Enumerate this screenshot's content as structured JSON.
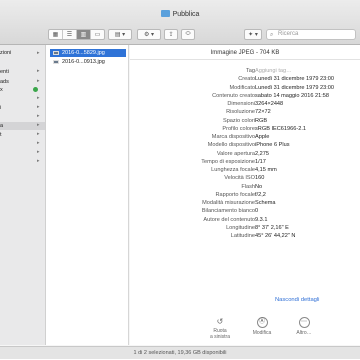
{
  "window": {
    "title": "Pubblica"
  },
  "toolbar": {
    "view_icons": [
      "▦",
      "☰",
      "▥",
      "▭"
    ],
    "group_icon": "▤ ▾",
    "action_icon": "⚙ ▾",
    "share_icon": "⇪",
    "tag_icon": "⬭",
    "dropbox_icon": "✦ ▾",
    "search_placeholder": "Ricerca"
  },
  "sidebar": {
    "items": [
      {
        "label": "zioni"
      },
      {
        "label": "enti"
      },
      {
        "label": "ads"
      },
      {
        "label": "x"
      },
      {
        "label": "i"
      },
      {
        "label": "a"
      },
      {
        "label": "t"
      }
    ]
  },
  "files": [
    {
      "name": "2016-0...5829.jpg",
      "selected": true
    },
    {
      "name": "2016-0...0913.jpg",
      "selected": false
    }
  ],
  "preview": {
    "kind": "Immagine JPEG - 704 KB",
    "rows": [
      {
        "key": "Tag",
        "value": "Aggiungi tag…"
      },
      {
        "key": "Creato",
        "value": "Lunedì 31 dicembre 1979 23:00"
      },
      {
        "key": "Modificato",
        "value": "Lunedì 31 dicembre 1979 23:00"
      },
      {
        "key": "Contenuto creato",
        "value": "sabato 14 maggio 2016 21:58"
      },
      {
        "key": "Dimensioni",
        "value": "3264×2448"
      },
      {
        "key": "Risoluzione",
        "value": "72×72"
      },
      {
        "key": "Spazio colori",
        "value": "RGB"
      },
      {
        "key": "Profilo colore",
        "value": "sRGB IEC61966-2.1"
      },
      {
        "key": "Marca dispositivo",
        "value": "Apple"
      },
      {
        "key": "Modello dispositivo",
        "value": "iPhone 6 Plus"
      },
      {
        "key": "Valore apertura",
        "value": "2,275"
      },
      {
        "key": "Tempo di esposizione",
        "value": "1/17"
      },
      {
        "key": "Lunghezza focale",
        "value": "4,15 mm"
      },
      {
        "key": "Velocità ISO",
        "value": "160"
      },
      {
        "key": "Flash",
        "value": "No"
      },
      {
        "key": "Rapporto focale",
        "value": "f/2,2"
      },
      {
        "key": "Modalità misurazione",
        "value": "Schema"
      },
      {
        "key": "Bilanciamento bianco",
        "value": "0"
      },
      {
        "key": "Autore del contenuto",
        "value": "9.3.1"
      },
      {
        "key": "Longitudine",
        "value": "8° 37' 2,16\" E"
      },
      {
        "key": "Latitudine",
        "value": "45° 26' 44,22\" N"
      }
    ],
    "hide_details": "Nascondi dettagli",
    "actions": [
      {
        "label": "Ruota\na sinistra",
        "icon": "↺"
      },
      {
        "label": "Modifica",
        "icon": "Ⓐ"
      },
      {
        "label": "Altro…",
        "icon": "⋯"
      }
    ]
  },
  "status": "1 di 2 selezionati, 19,36 GB disponibili"
}
